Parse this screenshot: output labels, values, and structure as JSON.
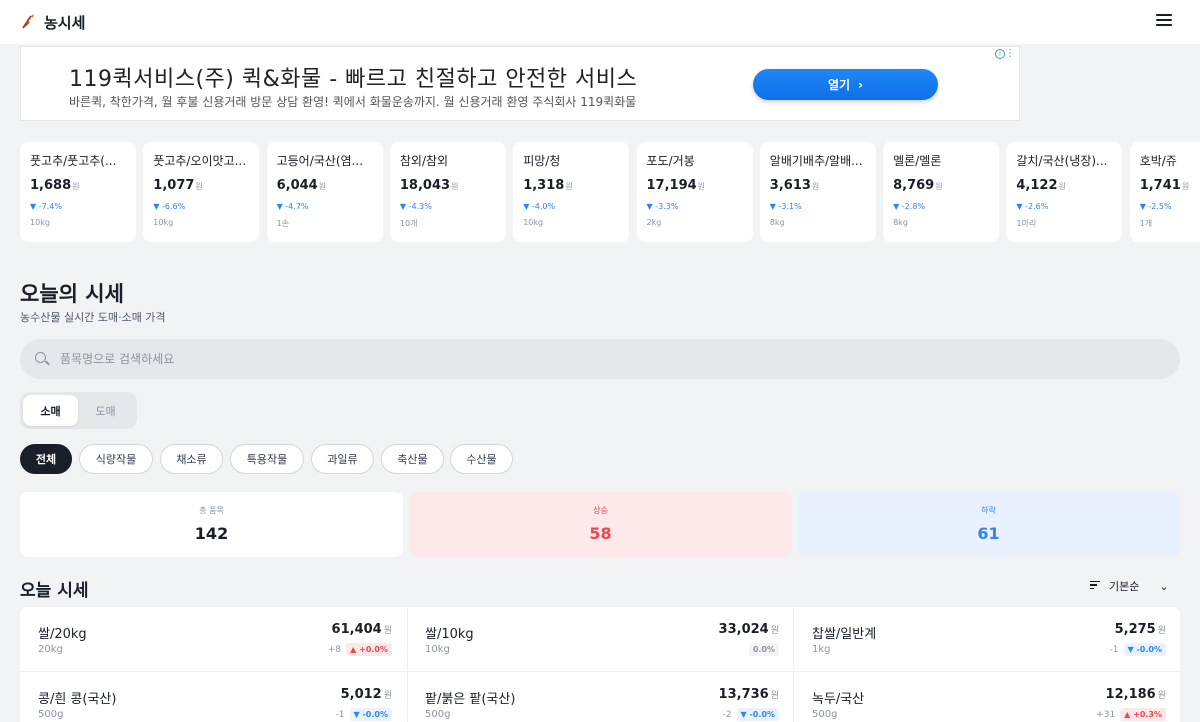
{
  "app": {
    "title": "농시세"
  },
  "ad": {
    "title": "119퀵서비스(주) 퀵&화물 - 빠르고 친절하고 안전한 서비스",
    "subtitle": "바른퀵, 착한가격, 월 후불 신용거래 방문 상담 환영! 퀵에서 화물운송까지. 월 신용거래 환영 주식회사 119퀵화물",
    "button_label": "열기",
    "button_icon": "chevron-right-icon"
  },
  "ticker": [
    {
      "name": "풋고추/풋고추(...",
      "price": "1,688",
      "currency": "원",
      "change": "-7.4%",
      "unit": "10kg"
    },
    {
      "name": "풋고추/오이맛고...",
      "price": "1,077",
      "currency": "원",
      "change": "-6.6%",
      "unit": "10kg"
    },
    {
      "name": "고등어/국산(염...",
      "price": "6,044",
      "currency": "원",
      "change": "-4.7%",
      "unit": "1손"
    },
    {
      "name": "참외/참외",
      "price": "18,043",
      "currency": "원",
      "change": "-4.3%",
      "unit": "10개"
    },
    {
      "name": "피망/청",
      "price": "1,318",
      "currency": "원",
      "change": "-4.0%",
      "unit": "10kg"
    },
    {
      "name": "포도/거봉",
      "price": "17,194",
      "currency": "원",
      "change": "-3.3%",
      "unit": "2kg"
    },
    {
      "name": "알배기배추/알배...",
      "price": "3,613",
      "currency": "원",
      "change": "-3.1%",
      "unit": "8kg"
    },
    {
      "name": "멜론/멜론",
      "price": "8,769",
      "currency": "원",
      "change": "-2.8%",
      "unit": "8kg"
    },
    {
      "name": "갈치/국산(냉장)...",
      "price": "4,122",
      "currency": "원",
      "change": "-2.6%",
      "unit": "1마리"
    },
    {
      "name": "호박/쥬",
      "price": "1,741",
      "currency": "원",
      "change": "-2.5%",
      "unit": "1개"
    }
  ],
  "section": {
    "title": "오늘의 시세",
    "subtitle": "농수산물 실시간 도매·소매 가격"
  },
  "search": {
    "placeholder": "품목명으로 검색하세요",
    "value": ""
  },
  "segments": [
    "소매",
    "도매"
  ],
  "active_segment": "소매",
  "categories": [
    "전체",
    "식량작물",
    "채소류",
    "특용작물",
    "과일류",
    "축산물",
    "수산물"
  ],
  "active_category": "전체",
  "stats": {
    "total": {
      "label": "총 품목",
      "value": "142",
      "color": "#191f28"
    },
    "up": {
      "label": "상승",
      "value": "58",
      "color": "#f04452"
    },
    "down": {
      "label": "하락",
      "value": "61",
      "color": "#3182f6"
    }
  },
  "list": {
    "title": "오늘 시세",
    "sort_label": "기본순",
    "items": [
      {
        "name": "쌀/20kg",
        "unit": "20kg",
        "price": "61,404",
        "currency": "원",
        "diff": "+8",
        "badge": "+0.0%",
        "dir": "up"
      },
      {
        "name": "쌀/10kg",
        "unit": "10kg",
        "price": "33,024",
        "currency": "원",
        "diff": "",
        "badge": "0.0%",
        "dir": "flat"
      },
      {
        "name": "찹쌀/일반계",
        "unit": "1kg",
        "price": "5,275",
        "currency": "원",
        "diff": "-1",
        "badge": "-0.0%",
        "dir": "down"
      },
      {
        "name": "콩/흰 콩(국산)",
        "unit": "500g",
        "price": "5,012",
        "currency": "원",
        "diff": "-1",
        "badge": "-0.0%",
        "dir": "down"
      },
      {
        "name": "팥/붉은 팥(국산)",
        "unit": "500g",
        "price": "13,736",
        "currency": "원",
        "diff": "-2",
        "badge": "-0.0%",
        "dir": "down"
      },
      {
        "name": "녹두/국산",
        "unit": "500g",
        "price": "12,186",
        "currency": "원",
        "diff": "+31",
        "badge": "+0.3%",
        "dir": "up"
      }
    ]
  },
  "colors": {
    "up": "#f04452",
    "down": "#3182f6",
    "accent": "#1a73e8"
  }
}
